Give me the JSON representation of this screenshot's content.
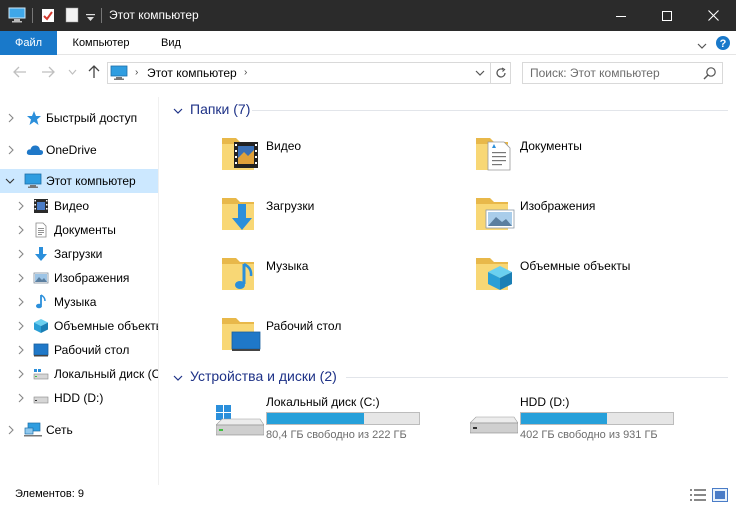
{
  "window": {
    "title": "Этот компьютер"
  },
  "ribbon": {
    "tabs": [
      {
        "label": "Файл"
      },
      {
        "label": "Компьютер"
      },
      {
        "label": "Вид"
      }
    ]
  },
  "address": {
    "crumb": "Этот компьютер"
  },
  "search": {
    "placeholder": "Поиск: Этот компьютер"
  },
  "sidebar": {
    "items": [
      {
        "label": "Быстрый доступ",
        "icon": "star-icon"
      },
      {
        "label": "OneDrive",
        "icon": "cloud-icon"
      },
      {
        "label": "Этот компьютер",
        "icon": "computer-icon",
        "selected": true
      },
      {
        "label": "Видео",
        "icon": "video-icon"
      },
      {
        "label": "Документы",
        "icon": "document-icon"
      },
      {
        "label": "Загрузки",
        "icon": "download-icon"
      },
      {
        "label": "Изображения",
        "icon": "image-icon"
      },
      {
        "label": "Музыка",
        "icon": "music-icon"
      },
      {
        "label": "Объемные объекты",
        "icon": "3d-object-icon"
      },
      {
        "label": "Рабочий стол",
        "icon": "desktop-icon"
      },
      {
        "label": "Локальный диск (C:)",
        "icon": "drive-icon"
      },
      {
        "label": "HDD (D:)",
        "icon": "drive-icon"
      },
      {
        "label": "Сеть",
        "icon": "network-icon"
      }
    ]
  },
  "folders_group": {
    "title": "Папки (7)",
    "items": [
      {
        "label": "Видео",
        "icon": "video-folder-icon"
      },
      {
        "label": "Документы",
        "icon": "documents-folder-icon"
      },
      {
        "label": "Загрузки",
        "icon": "downloads-folder-icon"
      },
      {
        "label": "Изображения",
        "icon": "pictures-folder-icon"
      },
      {
        "label": "Музыка",
        "icon": "music-folder-icon"
      },
      {
        "label": "Объемные объекты",
        "icon": "3d-objects-folder-icon"
      },
      {
        "label": "Рабочий стол",
        "icon": "desktop-folder-icon"
      }
    ]
  },
  "drives_group": {
    "title": "Устройства и диски (2)",
    "items": [
      {
        "label": "Локальный диск (C:)",
        "free_text": "80,4 ГБ свободно из 222 ГБ",
        "used_fraction": 0.638,
        "icon": "windows-drive-icon"
      },
      {
        "label": "HDD (D:)",
        "free_text": "402 ГБ свободно из 931 ГБ",
        "used_fraction": 0.568,
        "icon": "hdd-icon"
      }
    ]
  },
  "status": {
    "text": "Элементов: 9"
  },
  "colors": {
    "accent": "#1979ca",
    "selection": "#cce8ff",
    "group_header": "#1e3287",
    "drive_fill": "#26a0da"
  }
}
